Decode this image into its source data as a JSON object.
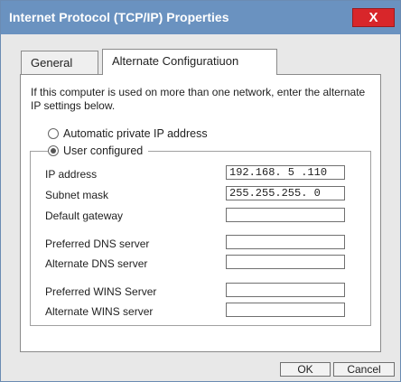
{
  "window": {
    "title": "Internet Protocol (TCP/IP) Properties",
    "close_label": "X"
  },
  "tabs": [
    {
      "label": "General",
      "active": false
    },
    {
      "label": "Alternate Configuratiuon",
      "active": true
    }
  ],
  "panel": {
    "intro": "If this computer is used on more than one network, enter the alternate IP settings below.",
    "options": {
      "automatic": {
        "label": "Automatic private IP address",
        "selected": false
      },
      "user": {
        "label": "User configured",
        "selected": true
      }
    },
    "fields": {
      "ip": {
        "label": "IP address",
        "value": "192.168. 5 .110"
      },
      "subnet": {
        "label": "Subnet mask",
        "value": "255.255.255. 0"
      },
      "gateway": {
        "label": "Default gateway",
        "value": ""
      },
      "pref_dns": {
        "label": "Preferred DNS server",
        "value": ""
      },
      "alt_dns": {
        "label": "Alternate DNS server",
        "value": ""
      },
      "pref_wins": {
        "label": "Preferred WINS Server",
        "value": ""
      },
      "alt_wins": {
        "label": "Alternate WINS server",
        "value": ""
      }
    }
  },
  "buttons": {
    "ok": "OK",
    "cancel": "Cancel"
  },
  "colors": {
    "titlebar": "#6a92c0",
    "close": "#d8262a"
  }
}
